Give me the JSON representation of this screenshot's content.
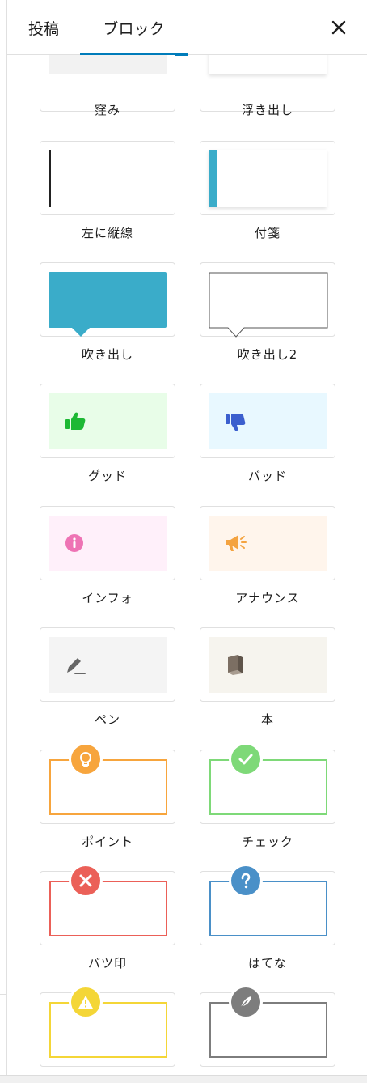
{
  "tabs": {
    "post": "投稿",
    "block": "ブロック"
  },
  "close_glyph": "✕",
  "styles": [
    {
      "label": "窪み"
    },
    {
      "label": "浮き出し"
    },
    {
      "label": "左に縦線"
    },
    {
      "label": "付箋"
    },
    {
      "label": "吹き出し"
    },
    {
      "label": "吹き出し2"
    },
    {
      "label": "グッド"
    },
    {
      "label": "バッド"
    },
    {
      "label": "インフォ"
    },
    {
      "label": "アナウンス"
    },
    {
      "label": "ペン"
    },
    {
      "label": "本"
    },
    {
      "label": "ポイント"
    },
    {
      "label": "チェック"
    },
    {
      "label": "バツ印"
    },
    {
      "label": "はてな"
    }
  ],
  "colors": {
    "accent": "#007cba",
    "teal": "#3aacc9",
    "good": "#1db834",
    "bad": "#3b5fce",
    "info": "#ee73b4",
    "announce": "#f4a340",
    "point": "#f7a53d",
    "check": "#7ed978",
    "cross": "#eb6058",
    "question": "#4a90c8",
    "alert": "#f4d637",
    "memo": "#7d7d7d"
  }
}
